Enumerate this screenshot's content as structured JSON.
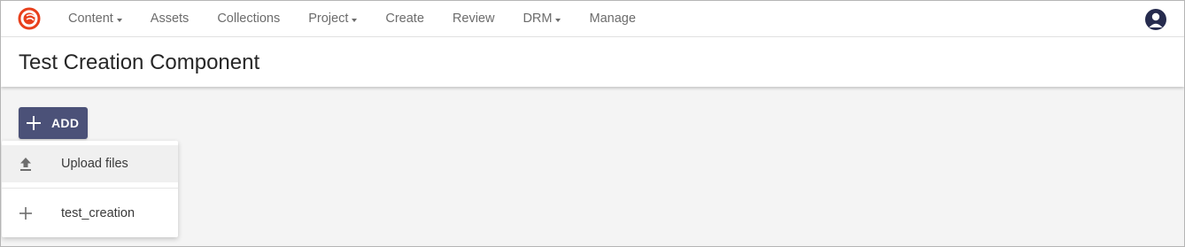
{
  "nav": {
    "items": [
      {
        "label": "Content",
        "dropdown": true
      },
      {
        "label": "Assets",
        "dropdown": false
      },
      {
        "label": "Collections",
        "dropdown": false
      },
      {
        "label": "Project",
        "dropdown": true
      },
      {
        "label": "Create",
        "dropdown": false
      },
      {
        "label": "Review",
        "dropdown": false
      },
      {
        "label": "DRM",
        "dropdown": true
      },
      {
        "label": "Manage",
        "dropdown": false
      }
    ]
  },
  "header": {
    "title": "Test Creation Component"
  },
  "add_button": {
    "label": "ADD"
  },
  "add_menu": {
    "items": [
      {
        "label": "Upload files",
        "icon": "upload-icon"
      },
      {
        "label": "test_creation",
        "icon": "plus-icon"
      }
    ]
  },
  "icons": {
    "logo": "app-logo-icon",
    "user": "user-avatar-icon"
  },
  "colors": {
    "brand": "#e8401c",
    "add_button": "#4b5178",
    "avatar": "#262b4e"
  }
}
